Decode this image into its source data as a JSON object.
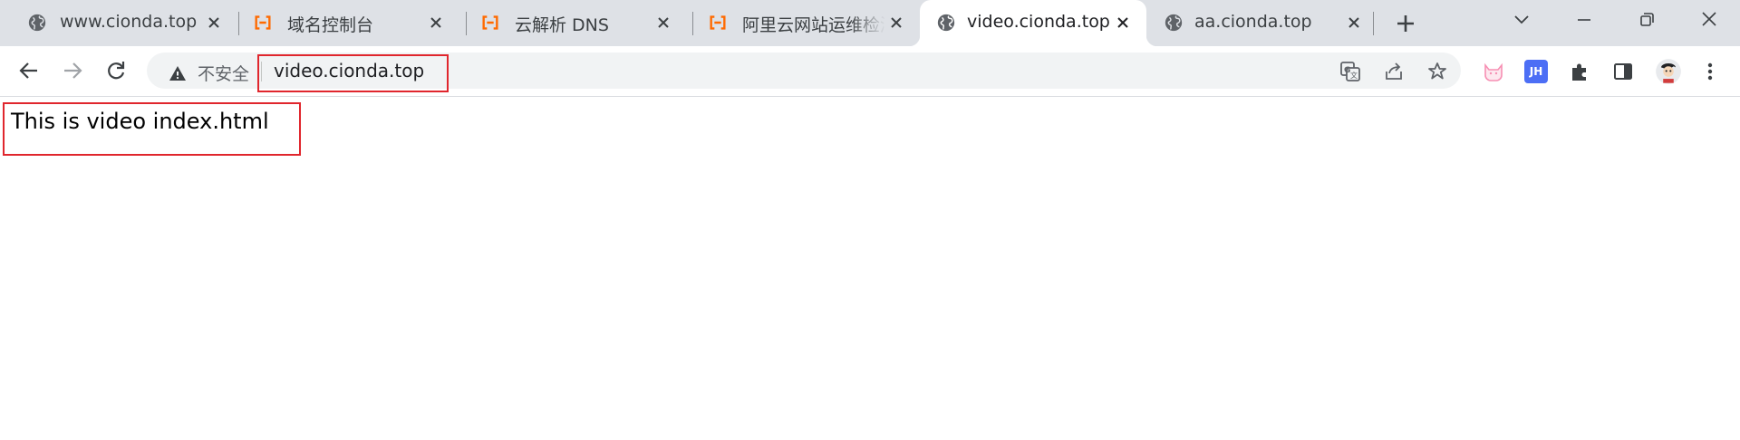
{
  "colors": {
    "tab_strip_bg": "#dee1e6",
    "active_tab_bg": "#ffffff",
    "omnibox_bg": "#f1f3f4",
    "aliyun_orange": "#ff6a00",
    "highlight_red": "#e0262d",
    "extension_blue": "#4c6ef5",
    "extension_pink": "#f78fb3"
  },
  "tabs": [
    {
      "title": "www.cionda.top",
      "icon": "globe-icon",
      "active": false
    },
    {
      "title": "域名控制台",
      "icon": "aliyun-icon",
      "active": false
    },
    {
      "title": "云解析 DNS",
      "icon": "aliyun-icon",
      "active": false
    },
    {
      "title": "阿里云网站运维检测",
      "icon": "aliyun-icon",
      "active": false
    },
    {
      "title": "video.cionda.top",
      "icon": "globe-icon",
      "active": true
    },
    {
      "title": "aa.cionda.top",
      "icon": "globe-icon",
      "active": false
    }
  ],
  "omnibox": {
    "security_label": "不安全",
    "security_icon": "warning-icon",
    "url": "video.cionda.top"
  },
  "extensions": {
    "jh_label": "JH"
  },
  "page": {
    "body_text": "This is video index.html"
  }
}
